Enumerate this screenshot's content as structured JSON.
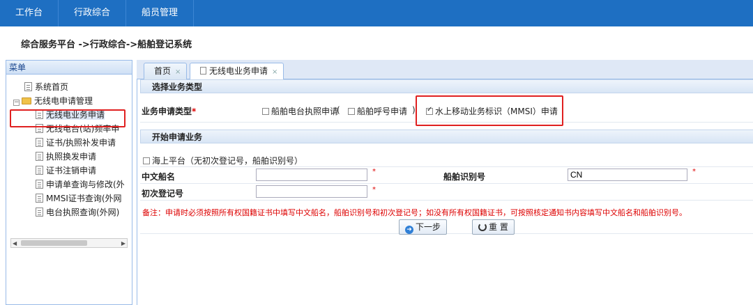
{
  "topnav": {
    "tabs": [
      "工作台",
      "行政综合",
      "船员管理"
    ]
  },
  "breadcrumb": "综合服务平台 ->行政综合->船舶登记系统",
  "sidebar": {
    "title": "菜单",
    "items": [
      {
        "label": "系统首页",
        "type": "leaf"
      },
      {
        "label": "无线电申请管理",
        "type": "folder"
      },
      {
        "label": "无线电业务申请",
        "type": "leaf",
        "selected": true
      },
      {
        "label": "无线电台(站)频率申",
        "type": "leaf"
      },
      {
        "label": "证书/执照补发申请",
        "type": "leaf"
      },
      {
        "label": "执照换发申请",
        "type": "leaf"
      },
      {
        "label": "证书注销申请",
        "type": "leaf"
      },
      {
        "label": "申请单查询与修改(外",
        "type": "leaf"
      },
      {
        "label": "MMSI证书查询(外网",
        "type": "leaf"
      },
      {
        "label": "电台执照查询(外网)",
        "type": "leaf"
      }
    ]
  },
  "tabs": [
    {
      "label": "首页",
      "close": "×"
    },
    {
      "label": "无线电业务申请",
      "close": "×"
    }
  ],
  "section1": {
    "title": "选择业务类型",
    "type_label": "业务申请类型",
    "required_mark": "*",
    "options": [
      {
        "label": "船舶电台执照申请",
        "checked": false
      },
      {
        "label": "船舶呼号申请",
        "checked": false
      },
      {
        "label": "水上移动业务标识（MMSI）申请",
        "checked": true
      }
    ],
    "paren_open": "(",
    "paren_close": ")"
  },
  "section2": {
    "title": "开始申请业务",
    "offshore_label": "海上平台（无初次登记号，船舶识别号）",
    "chinese_name_label": "中文船名",
    "chinese_name_value": "",
    "ship_id_label": "船舶识别号",
    "ship_id_value": "CN",
    "initial_reg_label": "初次登记号",
    "initial_reg_value": "",
    "required_mark": "*",
    "note": "备注：申请时必须按照所有权国籍证书中填写中文船名，船舶识别号和初次登记号；如没有所有权国籍证书，可按照核定通知书内容填写中文船名和船舶识别号。",
    "next_button": "下一步",
    "reset_button": "重 置"
  }
}
